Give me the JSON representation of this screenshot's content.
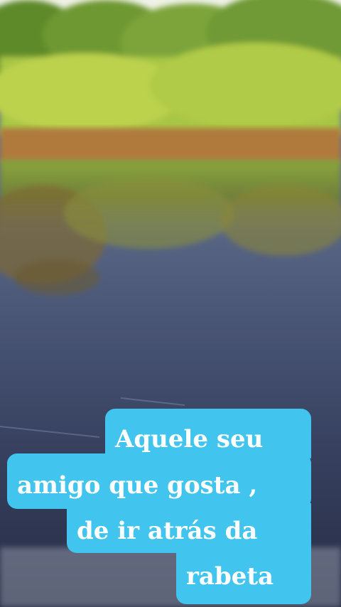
{
  "caption": {
    "lines": [
      "Aquele seu",
      "amigo que gosta ,",
      "de ir atrás da",
      "rabeta"
    ],
    "background_color": "#41c4ee",
    "text_color": "#ffffff"
  },
  "scene": {
    "colors": {
      "sky": "#e8f0e0",
      "foliage": "#9fc03a",
      "bank": "#b07a3c",
      "water_top": "#7f8fa6",
      "water_bottom": "#29324d"
    }
  }
}
